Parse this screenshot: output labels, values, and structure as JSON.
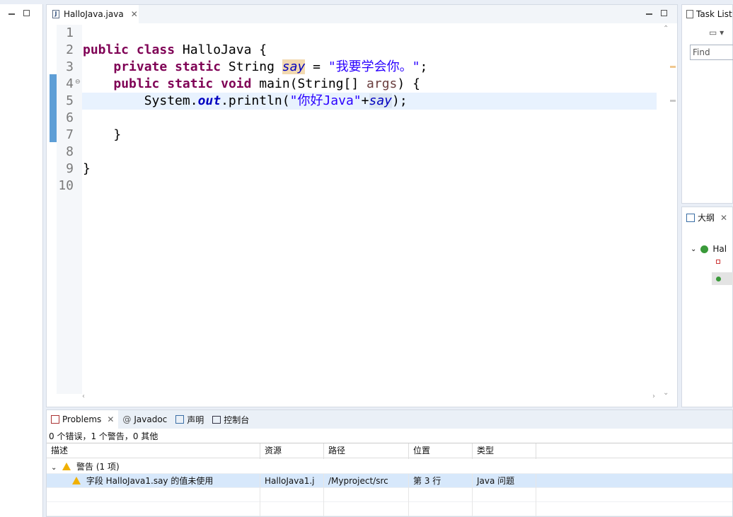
{
  "editor": {
    "tab_label": "HalloJava.java",
    "line_numbers": [
      "1",
      "2",
      "3",
      "4",
      "5",
      "6",
      "7",
      "8",
      "9",
      "10"
    ],
    "code": {
      "l2_kw1": "public",
      "l2_kw2": "class",
      "l2_rest": " HalloJava {",
      "l3_kw1": "private",
      "l3_kw2": "static",
      "l3_type": " String ",
      "l3_field": "say",
      "l3_eq": " = ",
      "l3_str": "\"我要学会你。\"",
      "l3_end": ";",
      "l4_kw1": "public",
      "l4_kw2": "static",
      "l4_kw3": "void",
      "l4_sig": " main(String[] ",
      "l4_args": "args",
      "l4_end": ") {",
      "l5_a": "System.",
      "l5_out": "out",
      "l5_b": ".println(",
      "l5_str": "\"你好Java\"",
      "l5_plus": "+",
      "l5_field": "say",
      "l5_end": ");",
      "l7": "}",
      "l9": "}"
    }
  },
  "task_list": {
    "title": "Task List",
    "find_placeholder": "Find"
  },
  "outline": {
    "title": "大纲",
    "root_label": "Hal"
  },
  "problems": {
    "tabs": [
      {
        "label": "Problems"
      },
      {
        "label": "Javadoc"
      },
      {
        "label": "声明"
      },
      {
        "label": "控制台"
      }
    ],
    "summary": "0 个错误，1 个警告，0 其他",
    "columns": [
      "描述",
      "资源",
      "路径",
      "位置",
      "类型"
    ],
    "group": "警告 (1 项)",
    "rows": [
      {
        "desc": "字段 HalloJava1.say 的值未使用",
        "resource": "HalloJava1.j",
        "path": "/Myproject/src",
        "location": "第 3 行",
        "type": "Java 问题"
      }
    ]
  }
}
